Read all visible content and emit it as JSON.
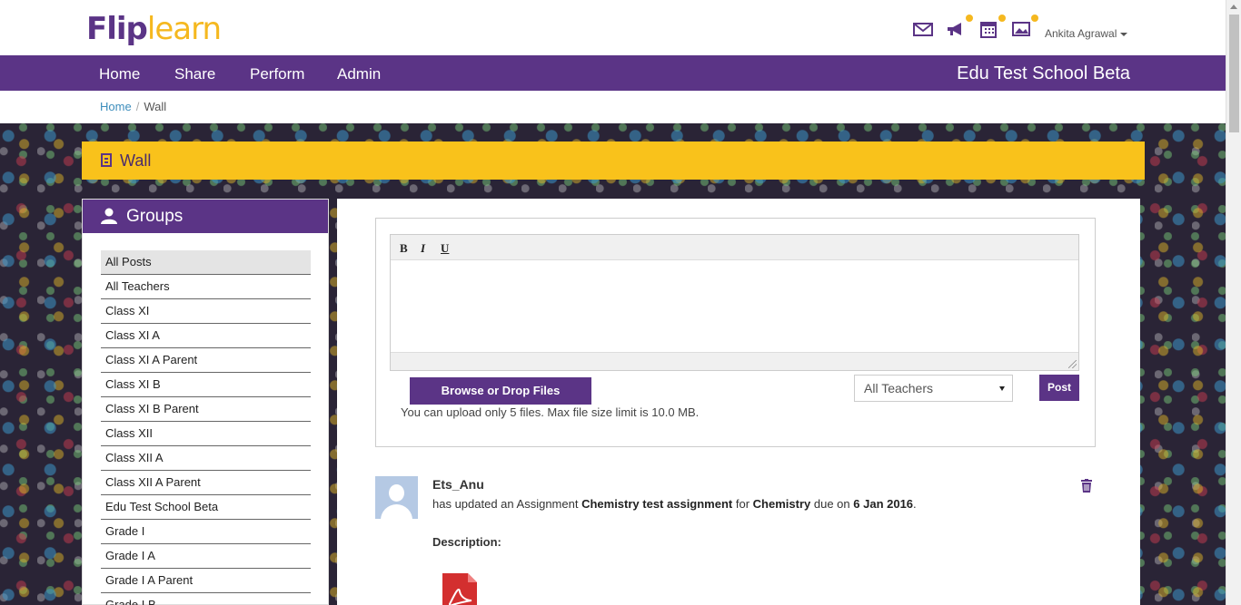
{
  "header": {
    "logo_part1": "Flip",
    "logo_part2": "learn",
    "icons": [
      "mail-icon",
      "megaphone-icon",
      "calendar-icon",
      "gallery-icon"
    ],
    "user_name": "Ankita Agrawal"
  },
  "nav": {
    "items": [
      "Home",
      "Share",
      "Perform",
      "Admin"
    ],
    "school_name": "Edu Test School Beta"
  },
  "breadcrumb": {
    "home": "Home",
    "separator": "/",
    "current": "Wall"
  },
  "wall": {
    "title": "Wall"
  },
  "groups": {
    "title": "Groups",
    "items": [
      "All Posts",
      "All Teachers",
      "Class XI",
      "Class XI A",
      "Class XI A Parent",
      "Class XI B",
      "Class XI B Parent",
      "Class XII",
      "Class XII A",
      "Class XII A Parent",
      "Edu Test School Beta",
      "Grade I",
      "Grade I A",
      "Grade I A Parent",
      "Grade I B"
    ],
    "active_index": 0
  },
  "composer": {
    "bold_label": "B",
    "italic_label": "I",
    "underline_label": "U",
    "browse_label": "Browse or Drop Files",
    "upload_note": "You can upload only 5 files. Max file size limit is 10.0 MB.",
    "audience_selected": "All Teachers",
    "post_label": "Post"
  },
  "feed": [
    {
      "author": "Ets_Anu",
      "action_prefix": "has updated an Assignment",
      "assignment": "Chemistry test assignment",
      "for_word": "for",
      "subject": "Chemistry",
      "due_word": "due on",
      "due_date": "6 Jan 2016",
      "end": ".",
      "description_label": "Description:"
    }
  ],
  "colors": {
    "brand_purple": "#5b3486",
    "brand_yellow": "#f9c21b",
    "link_blue": "#3c8dbc"
  }
}
